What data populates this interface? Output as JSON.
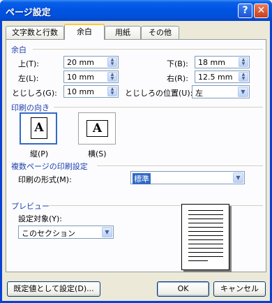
{
  "window": {
    "title": "ページ設定"
  },
  "titlebar": {
    "help_icon": "?",
    "close_icon": "✕"
  },
  "tabs": [
    {
      "label": "文字数と行数"
    },
    {
      "label": "余白"
    },
    {
      "label": "用紙"
    },
    {
      "label": "その他"
    }
  ],
  "margins": {
    "section_title": "余白",
    "top_label": "上(T):",
    "top_value": "20 mm",
    "bottom_label": "下(B):",
    "bottom_value": "18 mm",
    "left_label": "左(L):",
    "left_value": "10 mm",
    "right_label": "右(R):",
    "right_value": "12.5 mm",
    "gutter_label": "とじしろ(G):",
    "gutter_value": "10 mm",
    "gutter_pos_label": "とじしろの位置(U):",
    "gutter_pos_value": "左"
  },
  "orientation": {
    "section_title": "印刷の向き",
    "portrait_label": "縦(P)",
    "landscape_label": "横(S)",
    "page_glyph": "A"
  },
  "multiple_pages": {
    "section_title": "複数ページの印刷設定",
    "format_label": "印刷の形式(M):",
    "format_value": "標準"
  },
  "preview": {
    "section_title": "プレビュー",
    "apply_label": "設定対象(Y):",
    "apply_value": "このセクション"
  },
  "footer": {
    "default_button": "既定値として設定(D)...",
    "ok_button": "OK",
    "cancel_button": "キャンセル"
  }
}
